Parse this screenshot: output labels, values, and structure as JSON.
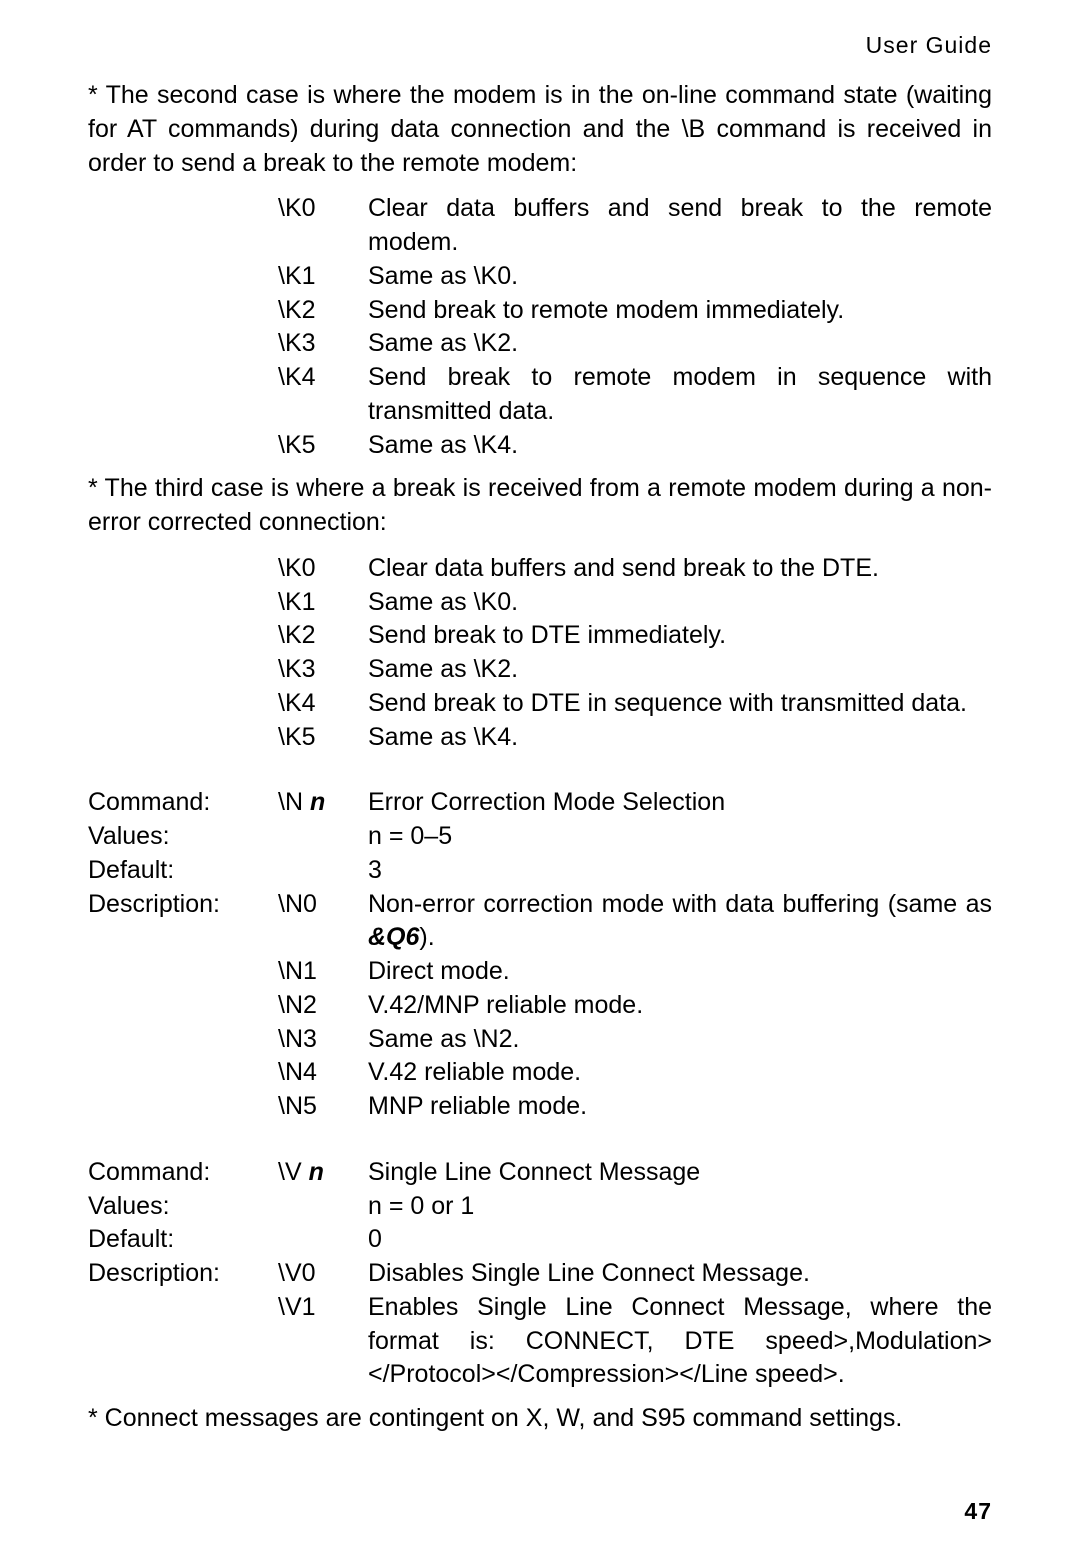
{
  "header": "User Guide",
  "para_intro2": "* The second case is where the modem is in the on-line command state (waiting for AT commands) during data connection and the \\B command is received in order to send a break to the remote modem:",
  "case2": [
    {
      "code": "\\K0",
      "desc": "Clear data buffers and send break to the remote modem."
    },
    {
      "code": "\\K1",
      "desc": "Same as \\K0."
    },
    {
      "code": "\\K2",
      "desc": "Send break to remote modem immediately."
    },
    {
      "code": "\\K3",
      "desc": "Same as \\K2."
    },
    {
      "code": "\\K4",
      "desc": "Send break to remote modem in sequence with transmitted data."
    },
    {
      "code": "\\K5",
      "desc": "Same as \\K4."
    }
  ],
  "para_intro3": "* The third case is where a break is received from a remote modem during a non-error corrected connection:",
  "case3": [
    {
      "code": "\\K0",
      "desc": "Clear data buffers and send break to the DTE."
    },
    {
      "code": "\\K1",
      "desc": "Same as \\K0."
    },
    {
      "code": "\\K2",
      "desc": "Send break to DTE immediately."
    },
    {
      "code": "\\K3",
      "desc": "Same as \\K2."
    },
    {
      "code": "\\K4",
      "desc": "Send break to DTE  in sequence with transmitted data."
    },
    {
      "code": "\\K5",
      "desc": "Same as \\K4."
    }
  ],
  "cmdN": {
    "command_label": "Command:",
    "command_val_pre": "\\N ",
    "command_val_em": "n",
    "title": "Error Correction Mode Selection",
    "values_label": "Values:",
    "values_val": "n = 0–5",
    "default_label": "Default:",
    "default_val": "3",
    "desc_label": "Description:",
    "items": [
      {
        "code": "\\N0",
        "desc_pre": "Non-error correction mode with data buffering (same as ",
        "desc_em": "&Q6",
        "desc_post": ")."
      },
      {
        "code": "\\N1",
        "desc": "Direct mode."
      },
      {
        "code": "\\N2",
        "desc": "V.42/MNP reliable mode."
      },
      {
        "code": "\\N3",
        "desc": "Same as \\N2."
      },
      {
        "code": "\\N4",
        "desc": "V.42 reliable mode."
      },
      {
        "code": "\\N5",
        "desc": "MNP reliable mode."
      }
    ]
  },
  "cmdV": {
    "command_label": "Command:",
    "command_val_pre": "\\V ",
    "command_val_em": "n",
    "title": "Single Line Connect Message",
    "values_label": "Values:",
    "values_val": "n = 0 or 1",
    "default_label": "Default:",
    "default_val": "0",
    "desc_label": "Description:",
    "items": [
      {
        "code": "\\V0",
        "desc": "Disables Single Line Connect Message."
      },
      {
        "code": "\\V1",
        "desc": "Enables Single Line Connect Message, where the format is: CONNECT, DTE speed>,Modulation></Protocol></Compression></Line speed>."
      }
    ]
  },
  "footnote": "* Connect messages are contingent on X, W, and S95 command settings.",
  "page_num": "47"
}
